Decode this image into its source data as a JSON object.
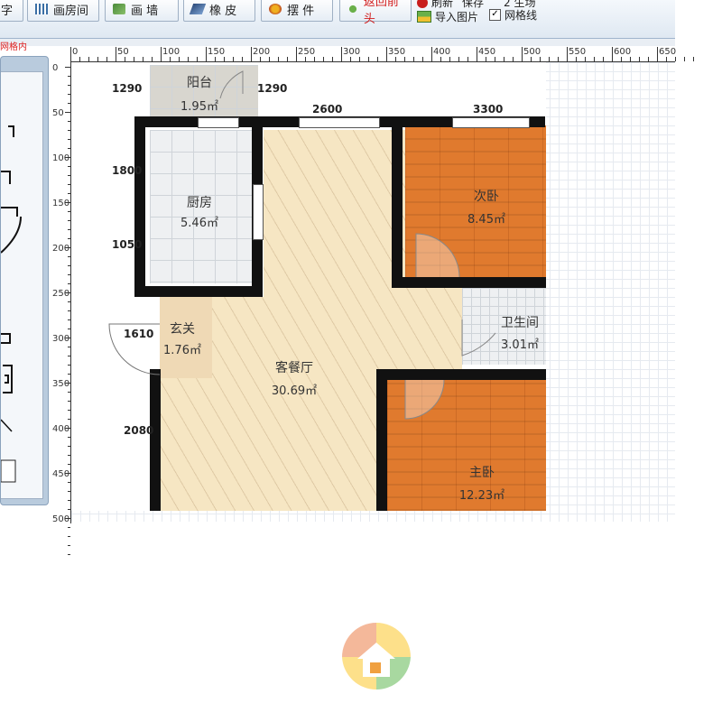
{
  "toolbar": {
    "buttons": [
      {
        "label": "字",
        "icon": "text-icon"
      },
      {
        "label": "画房间",
        "icon": "draw-room-icon"
      },
      {
        "label": "画 墙",
        "icon": "draw-wall-icon"
      },
      {
        "label": "橡 皮",
        "icon": "eraser-icon"
      },
      {
        "label": "摆 件",
        "icon": "furniture-icon"
      },
      {
        "label": "返回前头",
        "icon": "back-icon"
      }
    ],
    "import_image": "导入图片",
    "grid_lines": "网格线",
    "grid_checked": true,
    "refresh_partial": "刷新",
    "save_partial": "保存",
    "right_partial": "2 生场"
  },
  "tab_label": "网格内",
  "ruler": {
    "top_labels": [
      "0",
      "50",
      "100",
      "150",
      "200",
      "250",
      "300",
      "350",
      "400",
      "450",
      "500",
      "550",
      "600",
      "650"
    ],
    "left_labels": [
      "0",
      "50",
      "100",
      "150",
      "200",
      "250",
      "300",
      "350",
      "400",
      "450",
      "500"
    ]
  },
  "rooms": [
    {
      "name": "阳台",
      "area": "1.95㎡"
    },
    {
      "name": "厨房",
      "area": "5.46㎡"
    },
    {
      "name": "次卧",
      "area": "8.45㎡"
    },
    {
      "name": "卫生间",
      "area": "3.01㎡"
    },
    {
      "name": "玄关",
      "area": "1.76㎡"
    },
    {
      "name": "客餐厅",
      "area": "30.69㎡"
    },
    {
      "name": "主卧",
      "area": "12.23㎡"
    }
  ],
  "dimensions": [
    "1290",
    "1290",
    "2600",
    "3300",
    "1800",
    "1050",
    "1610",
    "2080"
  ],
  "colors": {
    "wood": "#e07a2e",
    "living": "#f6e6c3",
    "wall": "#111111",
    "toolbar": "#dfe8f2"
  }
}
